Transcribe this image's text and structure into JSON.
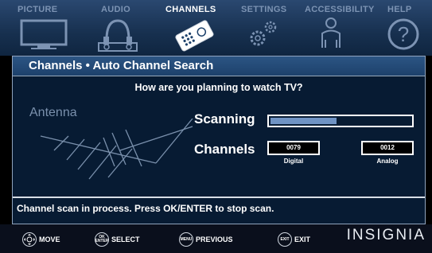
{
  "tabs": [
    {
      "label": "PICTURE",
      "icon": "tv-icon",
      "active": false
    },
    {
      "label": "AUDIO",
      "icon": "headphones-icon",
      "active": false
    },
    {
      "label": "CHANNELS",
      "icon": "remote-icon",
      "active": true
    },
    {
      "label": "SETTINGS",
      "icon": "gears-icon",
      "active": false
    },
    {
      "label": "ACCESSIBILITY",
      "icon": "person-icon",
      "active": false
    },
    {
      "label": "HELP",
      "icon": "help-icon",
      "active": false
    }
  ],
  "panel": {
    "title": "Channels • Auto Channel Search",
    "question": "How are you planning to watch TV?",
    "antenna_label": "Antenna",
    "scanning_label": "Scanning",
    "scan_progress": 0.47,
    "channels_label": "Channels",
    "digital_count": "0079",
    "digital_label": "Digital",
    "analog_count": "0012",
    "analog_label": "Analog",
    "status": "Channel scan in process. Press OK/ENTER to stop scan."
  },
  "bottom_bar": {
    "move": {
      "label": "MOVE"
    },
    "select": {
      "label": "SELECT",
      "key_text": "OK ENTER"
    },
    "previous": {
      "label": "PREVIOUS",
      "key_text": "MENU"
    },
    "exit": {
      "label": "EXIT",
      "key_text": "EXIT"
    },
    "brand": "INSIGNIA"
  },
  "colors": {
    "accent": "#6f93c4",
    "panel_bg": "#071b33",
    "active_tab": "#ffffff",
    "inactive_tab": "#7c93b3"
  }
}
